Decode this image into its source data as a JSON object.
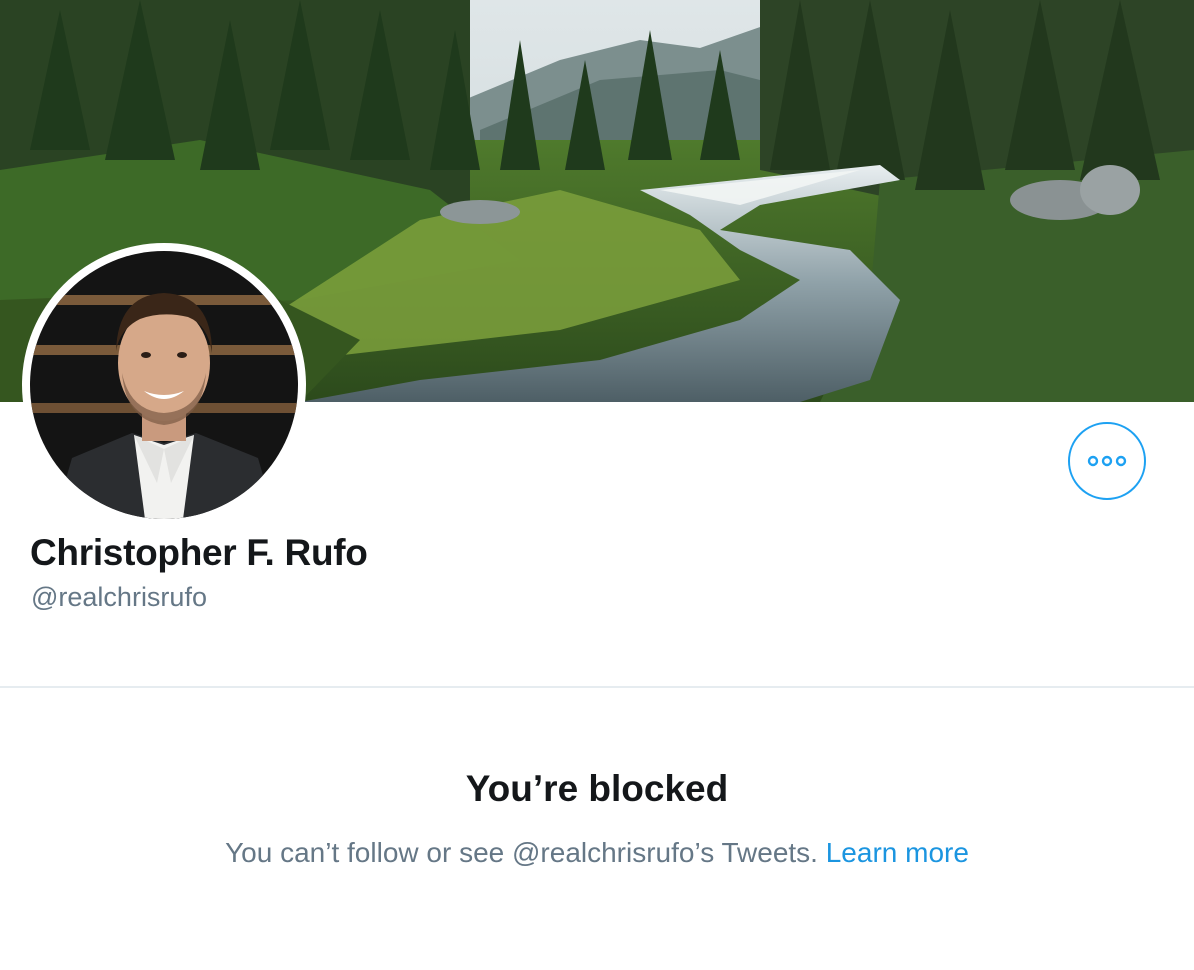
{
  "profile": {
    "name": "Christopher F. Rufo",
    "handle": "@realchrisrufo",
    "banner_icon": "mountain-stream-forest-photo",
    "avatar_icon": "profile-photo-man-in-suit"
  },
  "actions": {
    "more_icon": "ellipsis-icon"
  },
  "blocked": {
    "title": "You’re blocked",
    "message": "You can’t follow or see @realchrisrufo’s Tweets.",
    "learn_more": "Learn more"
  },
  "colors": {
    "accent": "#1da1f2",
    "link": "#1b95e0",
    "text_primary": "#14171a",
    "text_secondary": "#657786",
    "divider": "#e6ecf0"
  }
}
